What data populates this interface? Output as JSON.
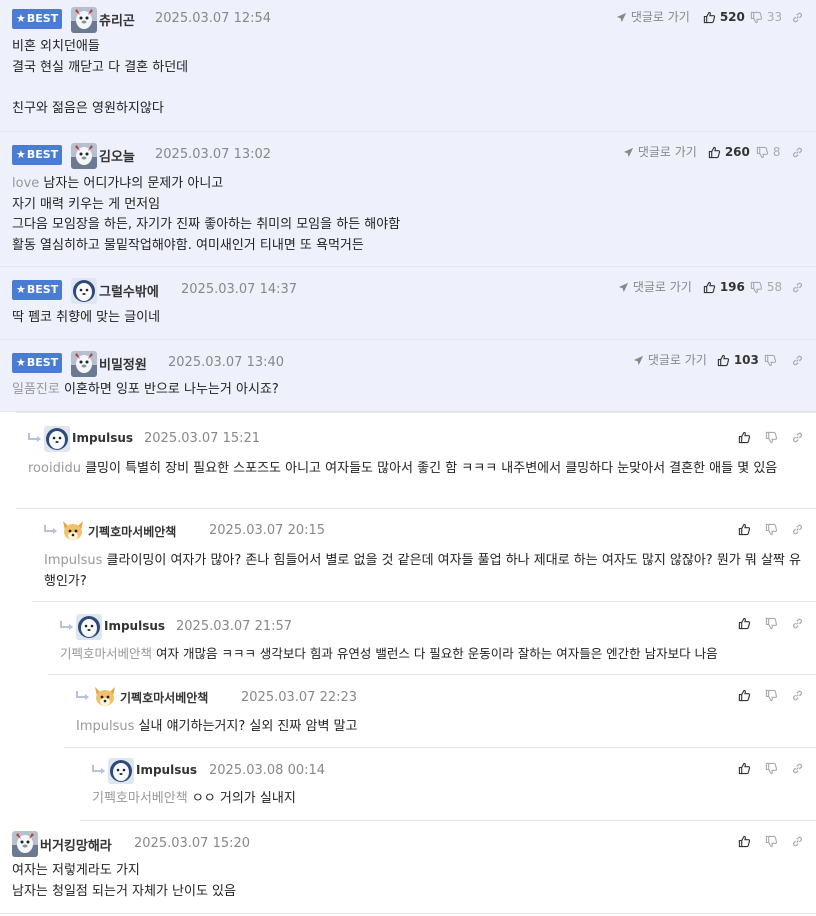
{
  "labels": {
    "best": "BEST",
    "reply_go": "댓글로 가기"
  },
  "colors": {
    "best_badge": "#4a7cd6",
    "best_row_bg": "#eef1fb",
    "mention": "#999999"
  },
  "comments": [
    {
      "best": true,
      "nick": "츄리곤",
      "time": "2025.03.07 12:54",
      "likes": "520",
      "dislikes": "33",
      "avatar": "penguin-avatar",
      "lines": [
        "비혼 외치던애들",
        "결국 현실 깨닫고 다 결혼 하던데",
        "",
        "친구와 젊음은 영원하지않다"
      ]
    },
    {
      "best": true,
      "nick": "김오늘",
      "time": "2025.03.07 13:02",
      "likes": "260",
      "dislikes": "8",
      "avatar": "penguin-avatar",
      "mention": "love",
      "lines": [
        "남자는 어디가냐의 문제가 아니고",
        "자기 매력 키우는 게 먼저임",
        "그다음 모임장을 하든, 자기가 진짜 좋아하는 취미의 모임을 하든 해야함",
        "활동 열심히하고 물밑작업해야함. 여미새인거 티내면 또 욕먹거든"
      ]
    },
    {
      "best": true,
      "nick": "그럴수밖에",
      "time": "2025.03.07 14:37",
      "likes": "196",
      "dislikes": "58",
      "avatar": "seal-avatar",
      "lines": [
        "딱 펨코 취향에 맞는 글이네"
      ]
    },
    {
      "best": true,
      "nick": "비밀정원",
      "time": "2025.03.07 13:40",
      "likes": "103",
      "dislikes": "",
      "avatar": "penguin-avatar",
      "mention": "일품진로",
      "lines": [
        "이혼하면 잉포 반으로 나누는거 아시죠?"
      ]
    },
    {
      "best": false,
      "nick": "Impulsus",
      "time": "2025.03.07 15:21",
      "avatar": "seal-avatar",
      "mention": "rooididu",
      "lines": [
        "클밍이 특별히 장비 필요한 스포즈도 아니고 여자들도 많아서 좋긴 함 ㅋㅋㅋ 내주변에서 클밍하다 눈맞아서 결혼한 애들 몇 있음"
      ]
    },
    {
      "best": false,
      "nick": "기펙호마서베안책",
      "time": "2025.03.07 20:15",
      "avatar": "dog-avatar",
      "mention": "Impulsus",
      "lines": [
        "클라이밍이 여자가 많아? 존나 힘들어서 별로 없을 것 같은데 여자들 풀업 하나 제대로 하는 여자도 많지 않잖아? 뭔가 뭐 살짝 유행인가?"
      ]
    },
    {
      "best": false,
      "nick": "Impulsus",
      "time": "2025.03.07 21:57",
      "avatar": "seal-avatar",
      "mention": "기펙호마서베안책",
      "lines": [
        "여자 개많음 ㅋㅋㅋ 생각보다 힘과 유연성 밸런스 다 필요한 운동이라 잘하는 여자들은 엔간한 남자보다 나음"
      ]
    },
    {
      "best": false,
      "nick": "기펙호마서베안책",
      "time": "2025.03.07 22:23",
      "avatar": "dog-avatar",
      "mention": "Impulsus",
      "lines": [
        "실내 얘기하는거지? 실외 진짜 암벽 말고"
      ]
    },
    {
      "best": false,
      "nick": "Impulsus",
      "time": "2025.03.08 00:14",
      "avatar": "seal-avatar",
      "mention": "기펙호마서베안책",
      "lines": [
        "ㅇㅇ 거의가 실내지"
      ]
    },
    {
      "best": false,
      "nick": "버거킹망해라",
      "time": "2025.03.07 15:20",
      "avatar": "penguin-avatar",
      "lines": [
        "여자는 저렇게라도 가지",
        "남자는 청일점 되는거 자체가 난이도 있음"
      ]
    }
  ]
}
